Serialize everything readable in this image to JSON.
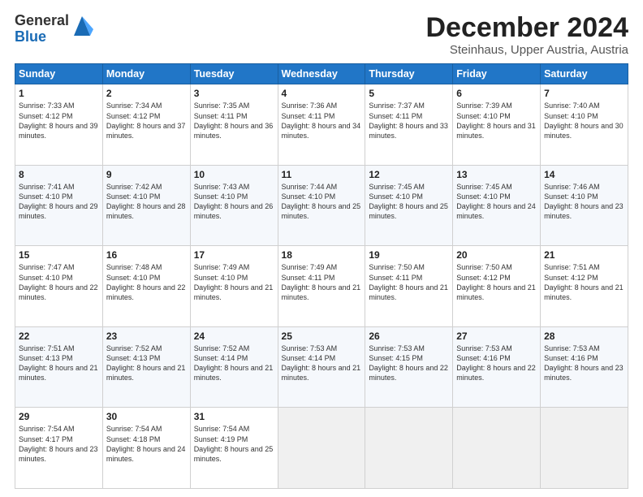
{
  "logo": {
    "general": "General",
    "blue": "Blue"
  },
  "header": {
    "month": "December 2024",
    "location": "Steinhaus, Upper Austria, Austria"
  },
  "weekdays": [
    "Sunday",
    "Monday",
    "Tuesday",
    "Wednesday",
    "Thursday",
    "Friday",
    "Saturday"
  ],
  "weeks": [
    [
      {
        "day": "1",
        "sunrise": "Sunrise: 7:33 AM",
        "sunset": "Sunset: 4:12 PM",
        "daylight": "Daylight: 8 hours and 39 minutes."
      },
      {
        "day": "2",
        "sunrise": "Sunrise: 7:34 AM",
        "sunset": "Sunset: 4:12 PM",
        "daylight": "Daylight: 8 hours and 37 minutes."
      },
      {
        "day": "3",
        "sunrise": "Sunrise: 7:35 AM",
        "sunset": "Sunset: 4:11 PM",
        "daylight": "Daylight: 8 hours and 36 minutes."
      },
      {
        "day": "4",
        "sunrise": "Sunrise: 7:36 AM",
        "sunset": "Sunset: 4:11 PM",
        "daylight": "Daylight: 8 hours and 34 minutes."
      },
      {
        "day": "5",
        "sunrise": "Sunrise: 7:37 AM",
        "sunset": "Sunset: 4:11 PM",
        "daylight": "Daylight: 8 hours and 33 minutes."
      },
      {
        "day": "6",
        "sunrise": "Sunrise: 7:39 AM",
        "sunset": "Sunset: 4:10 PM",
        "daylight": "Daylight: 8 hours and 31 minutes."
      },
      {
        "day": "7",
        "sunrise": "Sunrise: 7:40 AM",
        "sunset": "Sunset: 4:10 PM",
        "daylight": "Daylight: 8 hours and 30 minutes."
      }
    ],
    [
      {
        "day": "8",
        "sunrise": "Sunrise: 7:41 AM",
        "sunset": "Sunset: 4:10 PM",
        "daylight": "Daylight: 8 hours and 29 minutes."
      },
      {
        "day": "9",
        "sunrise": "Sunrise: 7:42 AM",
        "sunset": "Sunset: 4:10 PM",
        "daylight": "Daylight: 8 hours and 28 minutes."
      },
      {
        "day": "10",
        "sunrise": "Sunrise: 7:43 AM",
        "sunset": "Sunset: 4:10 PM",
        "daylight": "Daylight: 8 hours and 26 minutes."
      },
      {
        "day": "11",
        "sunrise": "Sunrise: 7:44 AM",
        "sunset": "Sunset: 4:10 PM",
        "daylight": "Daylight: 8 hours and 25 minutes."
      },
      {
        "day": "12",
        "sunrise": "Sunrise: 7:45 AM",
        "sunset": "Sunset: 4:10 PM",
        "daylight": "Daylight: 8 hours and 25 minutes."
      },
      {
        "day": "13",
        "sunrise": "Sunrise: 7:45 AM",
        "sunset": "Sunset: 4:10 PM",
        "daylight": "Daylight: 8 hours and 24 minutes."
      },
      {
        "day": "14",
        "sunrise": "Sunrise: 7:46 AM",
        "sunset": "Sunset: 4:10 PM",
        "daylight": "Daylight: 8 hours and 23 minutes."
      }
    ],
    [
      {
        "day": "15",
        "sunrise": "Sunrise: 7:47 AM",
        "sunset": "Sunset: 4:10 PM",
        "daylight": "Daylight: 8 hours and 22 minutes."
      },
      {
        "day": "16",
        "sunrise": "Sunrise: 7:48 AM",
        "sunset": "Sunset: 4:10 PM",
        "daylight": "Daylight: 8 hours and 22 minutes."
      },
      {
        "day": "17",
        "sunrise": "Sunrise: 7:49 AM",
        "sunset": "Sunset: 4:10 PM",
        "daylight": "Daylight: 8 hours and 21 minutes."
      },
      {
        "day": "18",
        "sunrise": "Sunrise: 7:49 AM",
        "sunset": "Sunset: 4:11 PM",
        "daylight": "Daylight: 8 hours and 21 minutes."
      },
      {
        "day": "19",
        "sunrise": "Sunrise: 7:50 AM",
        "sunset": "Sunset: 4:11 PM",
        "daylight": "Daylight: 8 hours and 21 minutes."
      },
      {
        "day": "20",
        "sunrise": "Sunrise: 7:50 AM",
        "sunset": "Sunset: 4:12 PM",
        "daylight": "Daylight: 8 hours and 21 minutes."
      },
      {
        "day": "21",
        "sunrise": "Sunrise: 7:51 AM",
        "sunset": "Sunset: 4:12 PM",
        "daylight": "Daylight: 8 hours and 21 minutes."
      }
    ],
    [
      {
        "day": "22",
        "sunrise": "Sunrise: 7:51 AM",
        "sunset": "Sunset: 4:13 PM",
        "daylight": "Daylight: 8 hours and 21 minutes."
      },
      {
        "day": "23",
        "sunrise": "Sunrise: 7:52 AM",
        "sunset": "Sunset: 4:13 PM",
        "daylight": "Daylight: 8 hours and 21 minutes."
      },
      {
        "day": "24",
        "sunrise": "Sunrise: 7:52 AM",
        "sunset": "Sunset: 4:14 PM",
        "daylight": "Daylight: 8 hours and 21 minutes."
      },
      {
        "day": "25",
        "sunrise": "Sunrise: 7:53 AM",
        "sunset": "Sunset: 4:14 PM",
        "daylight": "Daylight: 8 hours and 21 minutes."
      },
      {
        "day": "26",
        "sunrise": "Sunrise: 7:53 AM",
        "sunset": "Sunset: 4:15 PM",
        "daylight": "Daylight: 8 hours and 22 minutes."
      },
      {
        "day": "27",
        "sunrise": "Sunrise: 7:53 AM",
        "sunset": "Sunset: 4:16 PM",
        "daylight": "Daylight: 8 hours and 22 minutes."
      },
      {
        "day": "28",
        "sunrise": "Sunrise: 7:53 AM",
        "sunset": "Sunset: 4:16 PM",
        "daylight": "Daylight: 8 hours and 23 minutes."
      }
    ],
    [
      {
        "day": "29",
        "sunrise": "Sunrise: 7:54 AM",
        "sunset": "Sunset: 4:17 PM",
        "daylight": "Daylight: 8 hours and 23 minutes."
      },
      {
        "day": "30",
        "sunrise": "Sunrise: 7:54 AM",
        "sunset": "Sunset: 4:18 PM",
        "daylight": "Daylight: 8 hours and 24 minutes."
      },
      {
        "day": "31",
        "sunrise": "Sunrise: 7:54 AM",
        "sunset": "Sunset: 4:19 PM",
        "daylight": "Daylight: 8 hours and 25 minutes."
      },
      null,
      null,
      null,
      null
    ]
  ]
}
